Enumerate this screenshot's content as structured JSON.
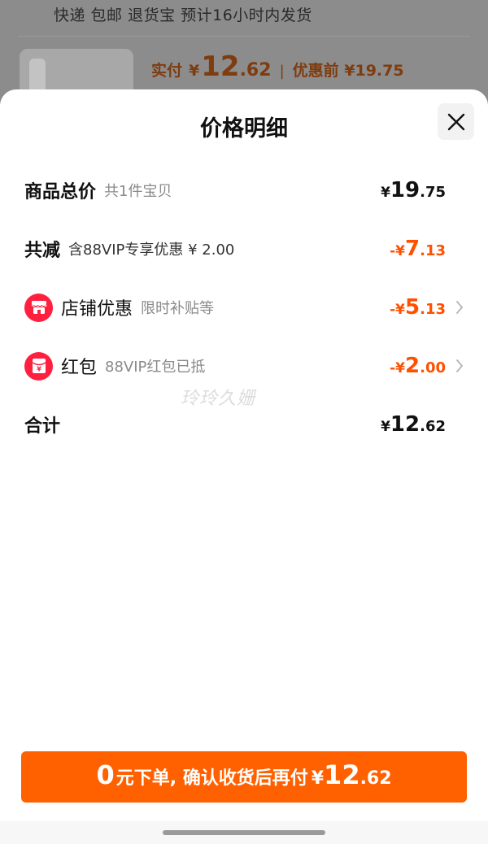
{
  "background": {
    "shipping_text": "快递 包邮 退货宝 预计16小时内发货",
    "price_label": "实付",
    "currency": "¥",
    "price_int": "12",
    "price_dec": ".62",
    "separator": "|",
    "pre_discount": "优惠前 ¥19.75"
  },
  "sheet": {
    "title": "价格明细",
    "rows": [
      {
        "label": "商品总价",
        "sub": "共1件宝贝",
        "cur": "¥",
        "int": "19",
        "dec": ".75"
      },
      {
        "label": "共减",
        "sub": "含88VIP专享优惠 ¥ 2.00",
        "cur": "-¥",
        "int": "7",
        "dec": ".13"
      },
      {
        "label": "店铺优惠",
        "sub": "限时补贴等",
        "cur": "-¥",
        "int": "5",
        "dec": ".13",
        "icon": "shop-icon"
      },
      {
        "label": "红包",
        "sub": "88VIP红包已抵",
        "cur": "-¥",
        "int": "2",
        "dec": ".00",
        "icon": "red-packet-icon"
      },
      {
        "label": "合计",
        "cur": "¥",
        "int": "12",
        "dec": ".62"
      }
    ],
    "watermark": "玲玲久姗"
  },
  "cta": {
    "zero": "0",
    "text": "元下单, 确认收货后再付",
    "cur": "¥",
    "int": "12",
    "dec": ".62"
  },
  "colors": {
    "accent": "#ff5000",
    "button": "#ff6100",
    "icon_red": "#ff2040"
  }
}
